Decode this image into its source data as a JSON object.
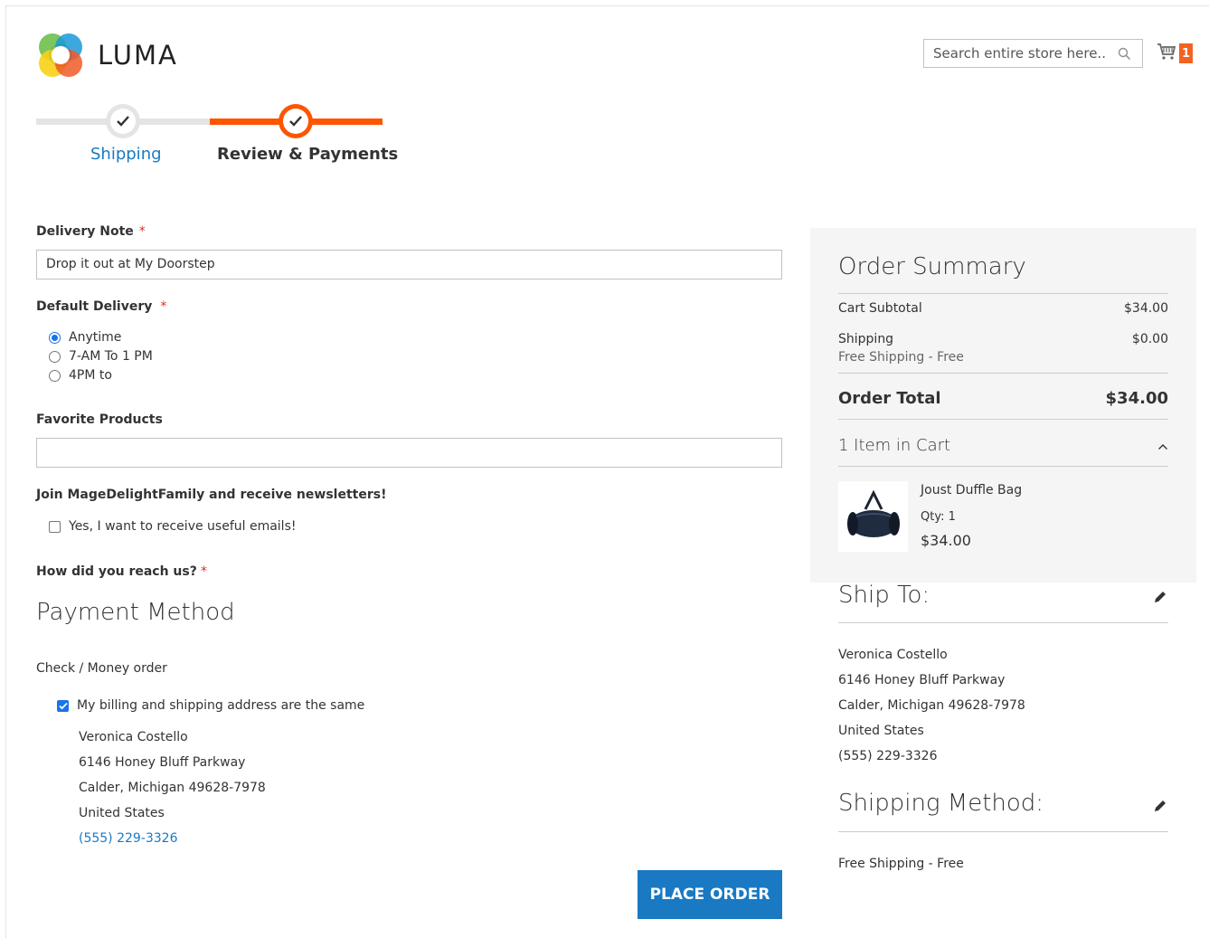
{
  "header": {
    "logo_text": "LUMA",
    "search_placeholder": "Search entire store here..",
    "cart_count": "1"
  },
  "progress": {
    "steps": [
      {
        "label": "Shipping",
        "complete": true
      },
      {
        "label": "Review & Payments",
        "active": true
      }
    ]
  },
  "form": {
    "delivery_note": {
      "label": "Delivery Note",
      "required_mark": "*",
      "value": "Drop it out at My Doorstep"
    },
    "default_delivery": {
      "label": "Default Delivery",
      "required_mark": "*",
      "options": [
        {
          "label": "Anytime",
          "checked": true
        },
        {
          "label": "7-AM To 1 PM",
          "checked": false
        },
        {
          "label": "4PM to",
          "checked": false
        }
      ]
    },
    "favorite_products": {
      "label": "Favorite Products",
      "value": ""
    },
    "newsletter": {
      "label": "Join MageDelightFamily and receive newsletters!",
      "checkbox_label": "Yes, I want to receive useful emails!",
      "checked": false
    },
    "reach_us": {
      "label": "How did you reach us?",
      "required_mark": "*"
    }
  },
  "payment": {
    "title": "Payment Method",
    "method": "Check / Money order",
    "same_address_label": "My billing and shipping address are the same",
    "same_address_checked": true,
    "address": {
      "name": "Veronica Costello",
      "street": "6146 Honey Bluff Parkway",
      "city": "Calder, Michigan 49628-7978",
      "country": "United States",
      "phone": "(555) 229-3326"
    },
    "place_order_label": "PLACE ORDER"
  },
  "summary": {
    "title": "Order Summary",
    "subtotal_label": "Cart Subtotal",
    "subtotal_value": "$34.00",
    "shipping_label": "Shipping",
    "shipping_value": "$0.00",
    "shipping_method": "Free Shipping - Free",
    "total_label": "Order Total",
    "total_value": "$34.00",
    "items_heading": "1 Item in Cart",
    "item": {
      "name": "Joust Duffle Bag",
      "qty": "Qty: 1",
      "price": "$34.00"
    }
  },
  "ship_to": {
    "title": "Ship To:",
    "name": "Veronica Costello",
    "street": "6146 Honey Bluff Parkway",
    "city": "Calder, Michigan 49628-7978",
    "country": "United States",
    "phone": "(555) 229-3326"
  },
  "shipping_method": {
    "title": "Shipping Method:",
    "value": "Free Shipping - Free"
  },
  "colors": {
    "accent_orange": "#ff5501",
    "link_blue": "#1979c3",
    "required_red": "#e02b27",
    "summary_bg": "#f5f5f5"
  }
}
